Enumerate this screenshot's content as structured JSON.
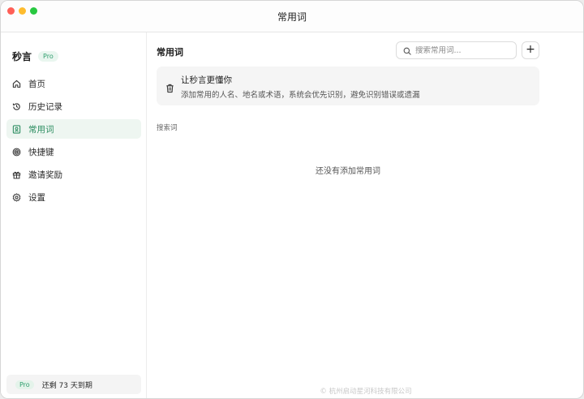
{
  "window": {
    "title": "常用词"
  },
  "sidebar": {
    "brand": "秒言",
    "badge": "Pro",
    "items": [
      {
        "label": "首页",
        "icon": "home-icon"
      },
      {
        "label": "历史记录",
        "icon": "history-icon"
      },
      {
        "label": "常用词",
        "icon": "vocabulary-icon",
        "active": true
      },
      {
        "label": "快捷键",
        "icon": "shortcut-icon"
      },
      {
        "label": "邀请奖励",
        "icon": "gift-icon"
      },
      {
        "label": "设置",
        "icon": "gear-icon"
      }
    ],
    "footer": {
      "badge": "Pro",
      "text": "还剩 73 天到期"
    }
  },
  "main": {
    "title": "常用词",
    "search": {
      "placeholder": "搜索常用词...",
      "value": ""
    },
    "add_label": "+",
    "tip": {
      "title": "让秒言更懂你",
      "description": "添加常用的人名、地名或术语，系统会优先识别，避免识别错误或遗漏"
    },
    "section_label": "搜索词",
    "empty_text": "还没有添加常用词",
    "copyright": "© 杭州启动星河科技有限公司"
  },
  "colors": {
    "accent": "#2f8f63",
    "active_bg": "#eef6f1"
  }
}
